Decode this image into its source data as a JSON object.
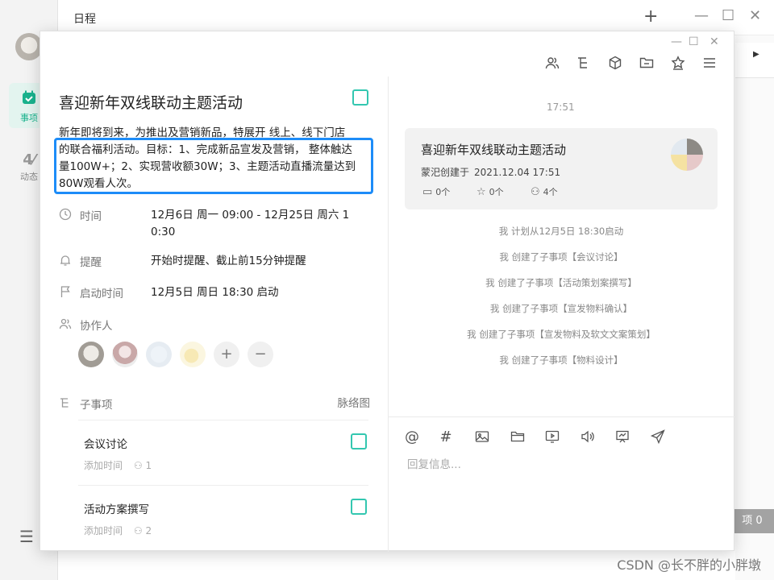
{
  "background_app": {
    "title": "日程",
    "nav": [
      {
        "label": "事项",
        "icon": "calendar-check-icon",
        "active": true
      },
      {
        "label": "动态",
        "icon": "activity-icon",
        "active": false
      }
    ],
    "badge": "项 0",
    "watermark": "CSDN @长不胖的小胖墩"
  },
  "task": {
    "title": "喜迎新年双线联动主题活动",
    "description_lines": [
      "新年即将到来，为推出及营销新品，特展开 线上、线下门店",
      "的联合福利活动。目标：1、完成新品宣发及营销， 整体触达",
      "量100W+；2、实现营收额30W；3、主题活动直播流量达到",
      "80W观看人次。"
    ],
    "time": {
      "label": "时间",
      "value_line1": "12月6日 周一 09:00  -  12月25日 周六 1",
      "value_line2": "0:30"
    },
    "reminder": {
      "label": "提醒",
      "value": "开始时提醒、截止前15分钟提醒"
    },
    "start": {
      "label": "启动时间",
      "value": "12月5日 周日 18:30 启动"
    },
    "collaborators": {
      "label": "协作人",
      "add": "+",
      "remove": "−"
    },
    "subtasks": {
      "label": "子事项",
      "link": "脉络图",
      "items": [
        {
          "name": "会议讨论",
          "meta": "添加时间",
          "count": "1"
        },
        {
          "name": "活动方案撰写",
          "meta": "添加时间",
          "count": "2"
        }
      ]
    }
  },
  "activity": {
    "time": "17:51",
    "card": {
      "title": "喜迎新年双线联动主题活动",
      "creator": "蒙汜创建于",
      "date": "2021.12.04 17:51",
      "files": "0个",
      "stars": "0个",
      "members": "4个"
    },
    "logs": [
      "我 计划从12月5日 18:30启动",
      "我 创建了子事项【会议讨论】",
      "我 创建了子事项【活动策划案撰写】",
      "我 创建了子事项【宣发物料确认】",
      "我 创建了子事项【宣发物料及软文文案策划】",
      "我 创建了子事项【物料设计】"
    ],
    "composer": {
      "placeholder": "回复信息...",
      "at": "@",
      "hash": "#"
    }
  },
  "colors": {
    "accent": "#33c7b0",
    "highlight": "#1d8cf8",
    "active_nav": "#19b28d"
  }
}
